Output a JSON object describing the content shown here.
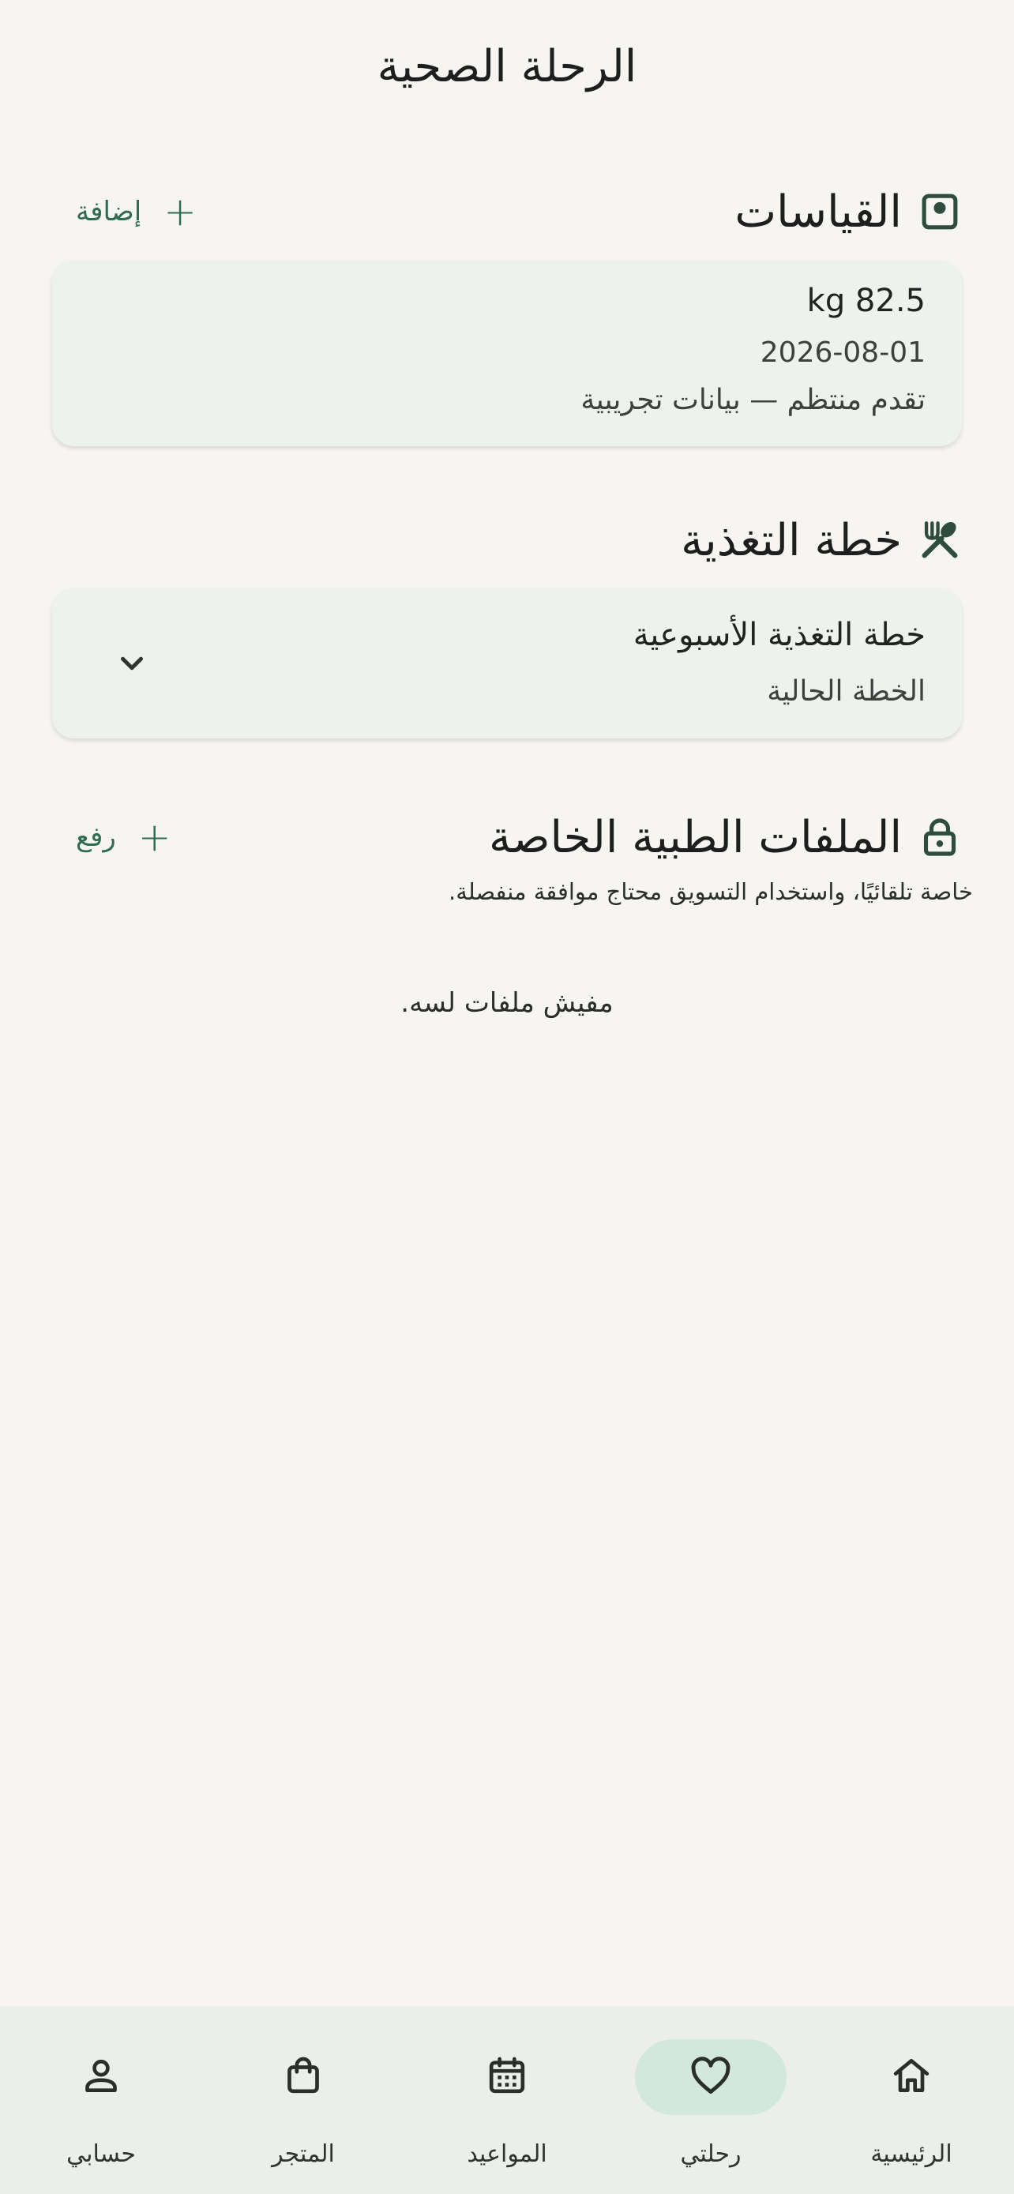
{
  "header": {
    "title": "الرحلة الصحية"
  },
  "measurements": {
    "title": "القياسات",
    "icon": "scale-icon",
    "add_label": "إضافة",
    "entry": {
      "value": "kg 82.5",
      "date": "2026-08-01",
      "note": "تقدم منتظم — بيانات تجريبية"
    }
  },
  "nutrition": {
    "title": "خطة التغذية",
    "icon": "utensils-icon",
    "plan_title": "خطة التغذية الأسبوعية",
    "plan_subtitle": "الخطة الحالية"
  },
  "medical_files": {
    "title": "الملفات الطبية الخاصة",
    "icon": "lock-icon",
    "upload_label": "رفع",
    "privacy_note": "خاصة تلقائيًا، واستخدام التسويق محتاج موافقة منفصلة.",
    "empty_text": "مفيش ملفات لسه."
  },
  "bottom_nav": {
    "items": [
      {
        "label": "الرئيسية",
        "icon": "home-icon"
      },
      {
        "label": "رحلتي",
        "icon": "heart-icon",
        "active": true
      },
      {
        "label": "المواعيد",
        "icon": "calendar-icon"
      },
      {
        "label": "المتجر",
        "icon": "shopping-bag-icon"
      },
      {
        "label": "حسابي",
        "icon": "person-icon"
      }
    ]
  },
  "colors": {
    "accent": "#2e6b4f",
    "background": "#f7f5f2",
    "card": "#eef2ef",
    "nav_active": "#d3e8dc"
  }
}
